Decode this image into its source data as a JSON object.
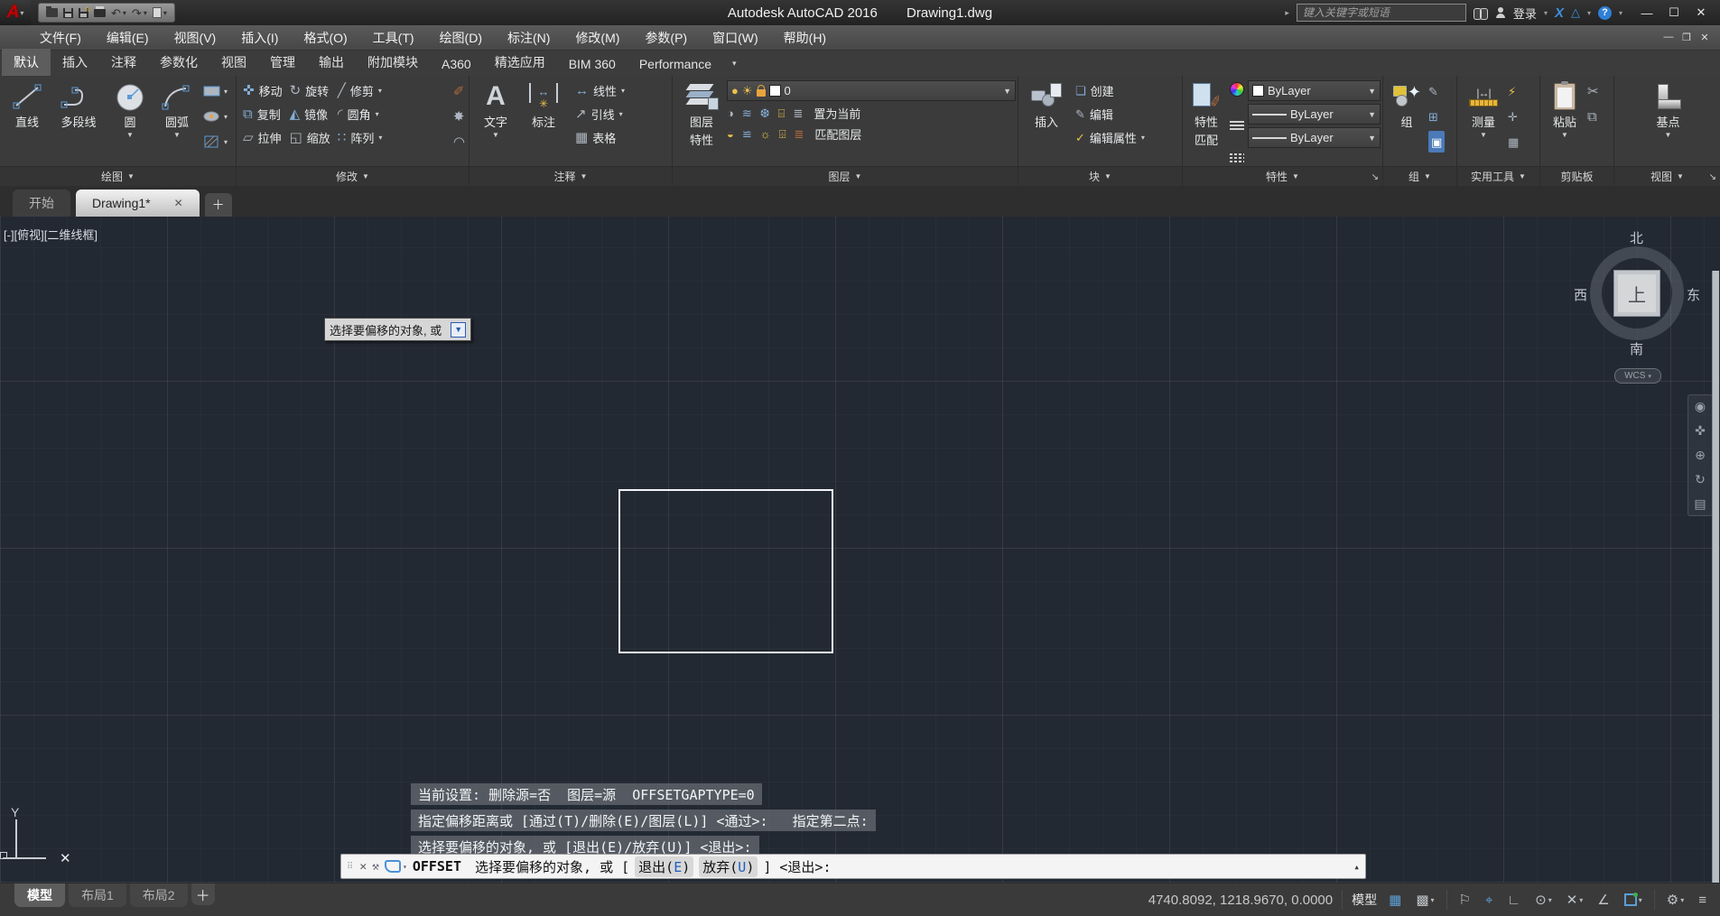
{
  "titlebar": {
    "app_title": "Autodesk AutoCAD 2016",
    "doc_title": "Drawing1.dwg",
    "search_placeholder": "键入关键字或短语",
    "signin": "登录",
    "exchange": "X",
    "help": "?"
  },
  "menubar": {
    "items": [
      "文件(F)",
      "编辑(E)",
      "视图(V)",
      "插入(I)",
      "格式(O)",
      "工具(T)",
      "绘图(D)",
      "标注(N)",
      "修改(M)",
      "参数(P)",
      "窗口(W)",
      "帮助(H)"
    ]
  },
  "ribbon": {
    "tabs": [
      "默认",
      "插入",
      "注释",
      "参数化",
      "视图",
      "管理",
      "输出",
      "附加模块",
      "A360",
      "精选应用",
      "BIM 360",
      "Performance"
    ],
    "draw": {
      "line": "直线",
      "pline": "多段线",
      "circle": "圆",
      "arc": "圆弧",
      "footer": "绘图"
    },
    "modify": {
      "move": "移动",
      "rotate": "旋转",
      "trim": "修剪",
      "copy": "复制",
      "mirror": "镜像",
      "fillet": "圆角",
      "stretch": "拉伸",
      "scale": "缩放",
      "array": "阵列",
      "footer": "修改"
    },
    "annotate": {
      "text": "文字",
      "dim": "标注",
      "linear": "线性",
      "leader": "引线",
      "table": "表格",
      "footer": "注释"
    },
    "layers": {
      "props_line1": "图层",
      "props_line2": "特性",
      "current_layer": "0",
      "set_current": "置为当前",
      "match_layer": "匹配图层",
      "footer": "图层"
    },
    "block": {
      "insert": "插入",
      "create": "创建",
      "edit": "编辑",
      "edit_attr": "编辑属性",
      "footer": "块"
    },
    "properties": {
      "match_line1": "特性",
      "match_line2": "匹配",
      "color": "ByLayer",
      "lineweight": "ByLayer",
      "linetype": "ByLayer",
      "footer": "特性"
    },
    "groups": {
      "group": "组",
      "footer": "组"
    },
    "utilities": {
      "measure": "测量",
      "footer": "实用工具"
    },
    "clipboard": {
      "paste": "粘贴",
      "footer": "剪贴板"
    },
    "view": {
      "base": "基点",
      "footer": "视图"
    }
  },
  "file_tabs": {
    "start": "开始",
    "drawing": "Drawing1*"
  },
  "canvas": {
    "viewport_label": "[-][俯视][二维线框]",
    "tooltip": "选择要偏移的对象, 或",
    "viewcube": {
      "n": "北",
      "s": "南",
      "e": "东",
      "w": "西",
      "top": "上",
      "wcs": "WCS"
    },
    "ucs_y": "Y"
  },
  "history": {
    "line1": "当前设置: 删除源=否  图层=源  OFFSETGAPTYPE=0",
    "line2": "指定偏移距离或 [通过(T)/删除(E)/图层(L)] <通过>:   指定第二点:",
    "line3": "选择要偏移的对象, 或 [退出(E)/放弃(U)] <退出>:"
  },
  "cmd": {
    "name": "OFFSET",
    "prompt": " 选择要偏移的对象, 或 [",
    "exit_pre": "退出(",
    "exit_key": "E",
    "undo_pre": "放弃(",
    "undo_key": "U",
    "paren": ")",
    "tail": "] <退出>:"
  },
  "statusbar": {
    "model_tab": "模型",
    "layout1": "布局1",
    "layout2": "布局2",
    "coords": "4740.8092, 1218.9670, 0.0000",
    "model_space": "模型"
  }
}
